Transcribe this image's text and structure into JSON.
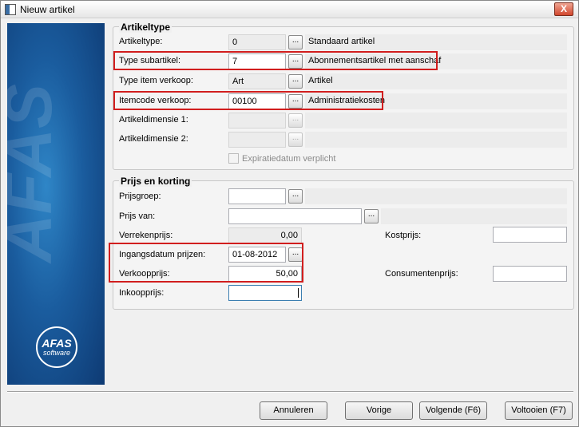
{
  "window": {
    "title": "Nieuw artikel",
    "close_label": "X"
  },
  "sidebar": {
    "logo_line1": "AFAS",
    "logo_line2": "software",
    "watermark": "AFAS"
  },
  "artikeltype": {
    "title": "Artikeltype",
    "rows": [
      {
        "label": "Artikeltype:",
        "value": "0",
        "description": "Standaard artikel"
      },
      {
        "label": "Type subartikel:",
        "value": "7",
        "description": "Abonnementsartikel met aanschaf"
      },
      {
        "label": "Type item verkoop:",
        "value": "Art",
        "description": "Artikel"
      },
      {
        "label": "Itemcode verkoop:",
        "value": "00100",
        "description": "Administratiekosten"
      },
      {
        "label": "Artikeldimensie 1:",
        "value": "",
        "description": ""
      },
      {
        "label": "Artikeldimensie 2:",
        "value": "",
        "description": ""
      }
    ],
    "expiratie_label": "Expiratiedatum verplicht"
  },
  "prijs": {
    "title": "Prijs en korting",
    "prijsgroep_label": "Prijsgroep:",
    "prijsgroep_value": "",
    "prijs_van_label": "Prijs van:",
    "prijs_van_value": "",
    "verrekenprijs_label": "Verrekenprijs:",
    "verrekenprijs_value": "0,00",
    "kostprijs_label": "Kostprijs:",
    "kostprijs_value": "",
    "ingangsdatum_label": "Ingangsdatum prijzen:",
    "ingangsdatum_value": "01-08-2012",
    "verkoopprijs_label": "Verkoopprijs:",
    "verkoopprijs_value": "50,00",
    "consumentenprijs_label": "Consumentenprijs:",
    "consumentenprijs_value": "",
    "inkoopprijs_label": "Inkoopprijs:",
    "inkoopprijs_value": ""
  },
  "lookup_label": "...",
  "buttons": {
    "annuleren": "Annuleren",
    "vorige": "Vorige",
    "volgende": "Volgende (F6)",
    "voltooien": "Voltooien (F7)"
  },
  "colors": {
    "highlight": "#d11e1e",
    "sidebar": "#1a5c9e"
  }
}
